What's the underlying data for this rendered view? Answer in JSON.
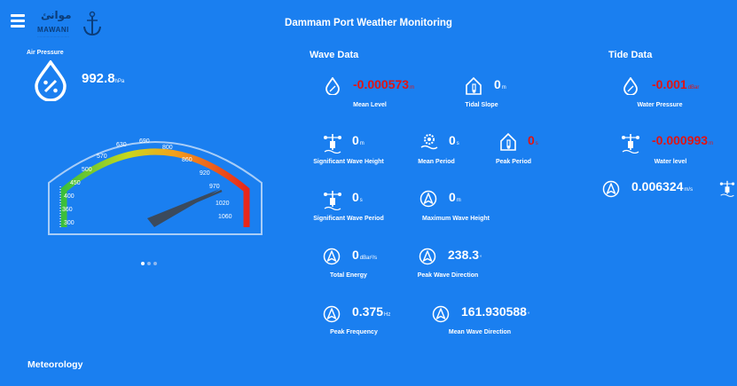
{
  "header": {
    "title": "Dammam Port Weather Monitoring",
    "logo_arabic": "موانئ",
    "logo_english": "MAWANI"
  },
  "air_pressure": {
    "label": "Air Pressure",
    "value": "992.8",
    "unit": "hPa",
    "gauge": {
      "ticks": [
        "300",
        "360",
        "400",
        "450",
        "500",
        "570",
        "630",
        "690",
        "800",
        "860",
        "920",
        "970",
        "1020",
        "1060"
      ]
    }
  },
  "carousel": {
    "pages": 3,
    "active": 0
  },
  "wave_data": {
    "heading": "Wave Data",
    "mean_level": {
      "value": "-0.000573",
      "unit": "m",
      "label": "Mean Level"
    },
    "tidal_slope": {
      "value": "0",
      "unit": "m",
      "label": "Tidal Slope"
    },
    "significant_wave_height": {
      "value": "0",
      "unit": "m",
      "label": "Significant Wave Height"
    },
    "mean_period": {
      "value": "0",
      "unit": "s",
      "label": "Mean Period"
    },
    "peak_period": {
      "value": "0",
      "unit": "s",
      "label": "Peak Period"
    },
    "significant_wave_period": {
      "value": "0",
      "unit": "s",
      "label": "Significant Wave Period"
    },
    "maximum_wave_height": {
      "value": "0",
      "unit": "m",
      "label": "Maximum Wave Height"
    },
    "total_energy": {
      "value": "0",
      "unit": "dBar²/s",
      "label": "Total Energy"
    },
    "peak_wave_direction": {
      "value": "238.3",
      "unit": "°",
      "label": "Peak Wave Direction"
    },
    "peak_frequency": {
      "value": "0.375",
      "unit": "Hz",
      "label": "Peak Frequency"
    },
    "mean_wave_direction": {
      "value": "161.930588",
      "unit": "°",
      "label": "Mean Wave Direction"
    }
  },
  "tide_data": {
    "heading": "Tide Data",
    "water_pressure": {
      "value": "-0.001",
      "unit": "dBar",
      "label": "Water Pressure"
    },
    "water_level": {
      "value": "-0.000993",
      "unit": "m",
      "label": "Water level"
    },
    "current_speed": {
      "value": "0.006324",
      "unit": "m/s"
    }
  },
  "meteorology": {
    "heading": "Meteorology"
  },
  "colors": {
    "background": "#1a7ff0",
    "negative": "#e01414",
    "text": "#ffffff"
  }
}
